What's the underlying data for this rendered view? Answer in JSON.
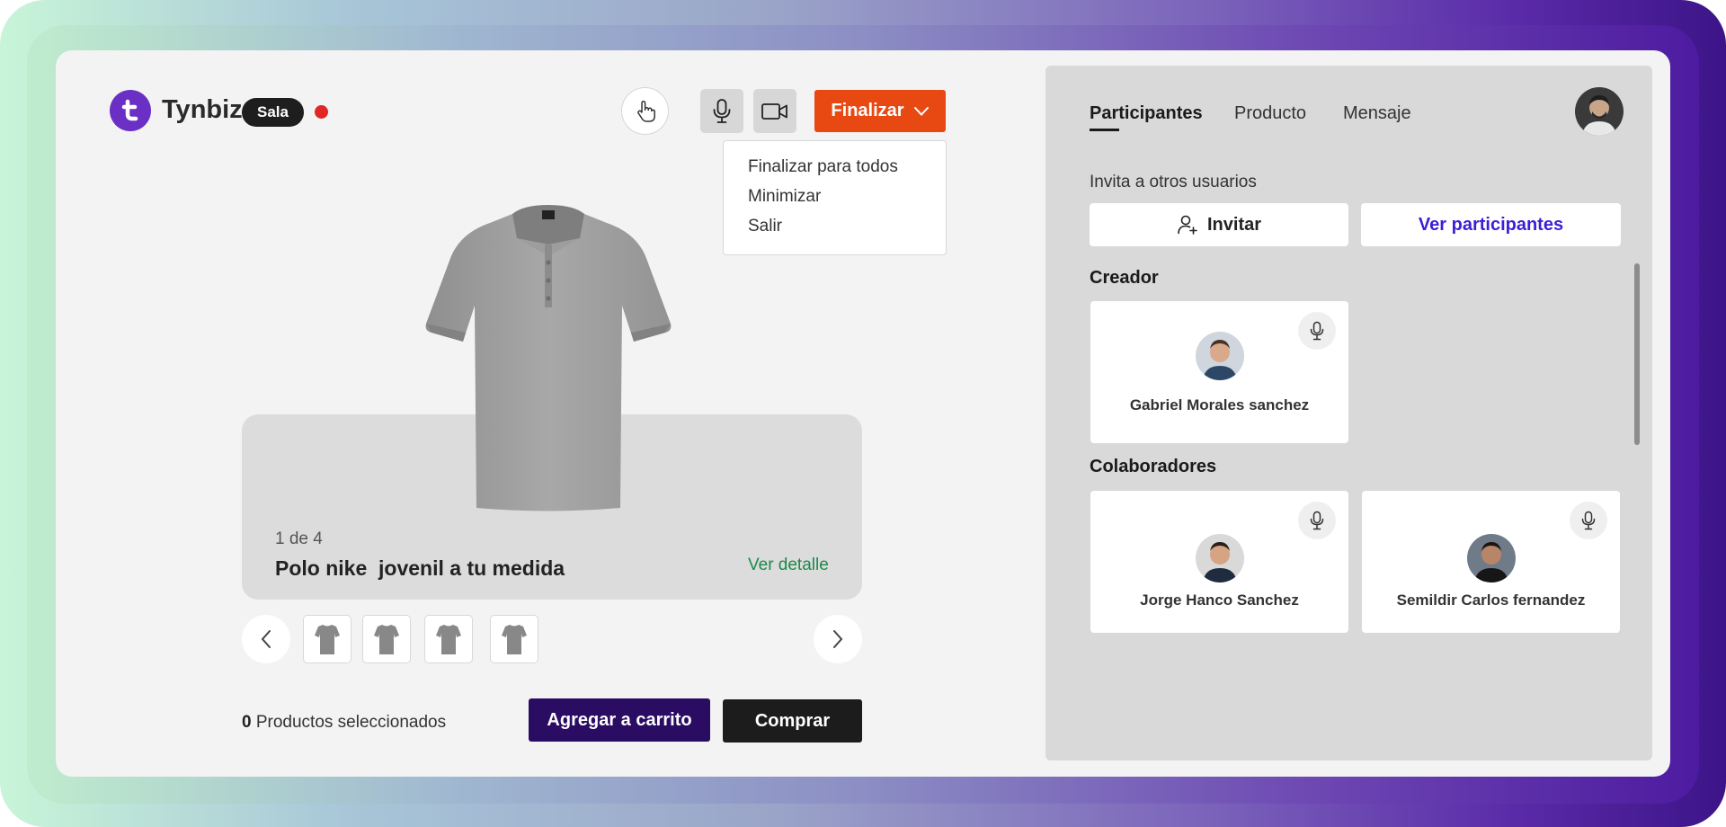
{
  "app": {
    "brand": "Tynbiz",
    "room_badge": "Sala"
  },
  "controls": {
    "hand_icon": "raise-hand-icon",
    "mic_icon": "microphone-icon",
    "camera_icon": "video-camera-icon",
    "finalizar_label": "Finalizar",
    "dropdown": [
      "Finalizar para todos",
      "Minimizar",
      "Salir"
    ]
  },
  "product": {
    "counter": "1 de 4",
    "title": "Polo nike  jovenil a tu medida",
    "detail_link": "Ver detalle",
    "thumbnail_count": 4
  },
  "cart": {
    "selected_count": "0",
    "selected_label": "Productos seleccionados",
    "add_to_cart": "Agregar a carrito",
    "buy": "Comprar"
  },
  "panel": {
    "tabs": [
      "Participantes",
      "Producto",
      "Mensaje"
    ],
    "active_tab": "Participantes",
    "invite_prompt": "Invita a otros usuarios",
    "invite_button": "Invitar",
    "view_participants_button": "Ver participantes",
    "creator_section": "Creador",
    "collaborators_section": "Colaboradores",
    "creator": {
      "name": "Gabriel Morales sanchez"
    },
    "collaborators": [
      {
        "name": "Jorge Hanco Sanchez"
      },
      {
        "name": "Semildir Carlos fernandez"
      }
    ]
  },
  "colors": {
    "brand": "#6a2fc4",
    "finalizar": "#e84812",
    "add_to_cart": "#2b0c63",
    "detail_link": "#1d8a4c",
    "view_participants": "#3a1fd8",
    "recording": "#e22525"
  }
}
